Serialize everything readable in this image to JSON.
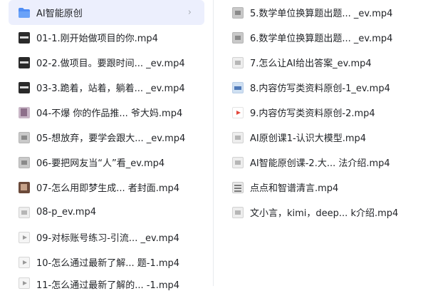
{
  "left_items": [
    {
      "label": "AI智能原创",
      "icon": "folder-icon",
      "type": "folder",
      "selected": true
    },
    {
      "label": "01-1.刚开始做项目的你.mp4",
      "icon": "video-thumb-dark",
      "type": "video"
    },
    {
      "label": "02-2.做项目。要跟时间... _ev.mp4",
      "icon": "video-thumb-dark",
      "type": "video"
    },
    {
      "label": "03-3.跪着，站着，躺着... _ev.mp4",
      "icon": "video-thumb-dark",
      "type": "video"
    },
    {
      "label": "04-不爆 你的作品推... 爷大妈.mp4",
      "icon": "video-thumb-mauve",
      "type": "video"
    },
    {
      "label": "05-想放弃，要学会跟大... _ev.mp4",
      "icon": "video-thumb-gray",
      "type": "video"
    },
    {
      "label": "06-要把网友当“人”看_ev.mp4",
      "icon": "video-thumb-gray",
      "type": "video"
    },
    {
      "label": "07-怎么用即梦生成... 者封面.mp4",
      "icon": "video-thumb-brown",
      "type": "video"
    },
    {
      "label": "08-p_ev.mp4",
      "icon": "video-thumb-light",
      "type": "video"
    },
    {
      "label": "09-对标账号练习-引流... _ev.mp4",
      "icon": "video-thumb-play",
      "type": "video"
    },
    {
      "label": "10-怎么通过最新了解... 题-1.mp4",
      "icon": "video-thumb-play",
      "type": "video"
    },
    {
      "label": "11-怎么通过最新了解的... -1.mp4",
      "icon": "video-thumb-play",
      "type": "video",
      "cut": true
    }
  ],
  "right_items": [
    {
      "label": "5.数学单位换算题出题... _ev.mp4",
      "icon": "video-thumb-gray",
      "type": "video"
    },
    {
      "label": "6.数学单位换算题出题... _ev.mp4",
      "icon": "video-thumb-gray",
      "type": "video"
    },
    {
      "label": "7.怎么让AI给出答案_ev.mp4",
      "icon": "video-thumb-light",
      "type": "video"
    },
    {
      "label": "8.内容仿写类资料原创-1_ev.mp4",
      "icon": "video-thumb-blue",
      "type": "video"
    },
    {
      "label": "9.内容仿写类资料原创-2.mp4",
      "icon": "video-thumb-redplay",
      "type": "video"
    },
    {
      "label": "AI原创课1-认识大模型.mp4",
      "icon": "video-thumb-light",
      "type": "video"
    },
    {
      "label": "AI智能原创课-2.大... 法介绍.mp4",
      "icon": "video-thumb-light",
      "type": "video"
    },
    {
      "label": "点点和智谱清言.mp4",
      "icon": "video-thumb-grid",
      "type": "video"
    },
    {
      "label": "文小言，kimi，deep... k介绍.mp4",
      "icon": "video-thumb-light",
      "type": "video"
    }
  ],
  "colors": {
    "selected_bg": "#eceffd",
    "folder": "#4f8df5",
    "divider": "#e8eaee",
    "text": "#222428"
  },
  "chevron": "›"
}
